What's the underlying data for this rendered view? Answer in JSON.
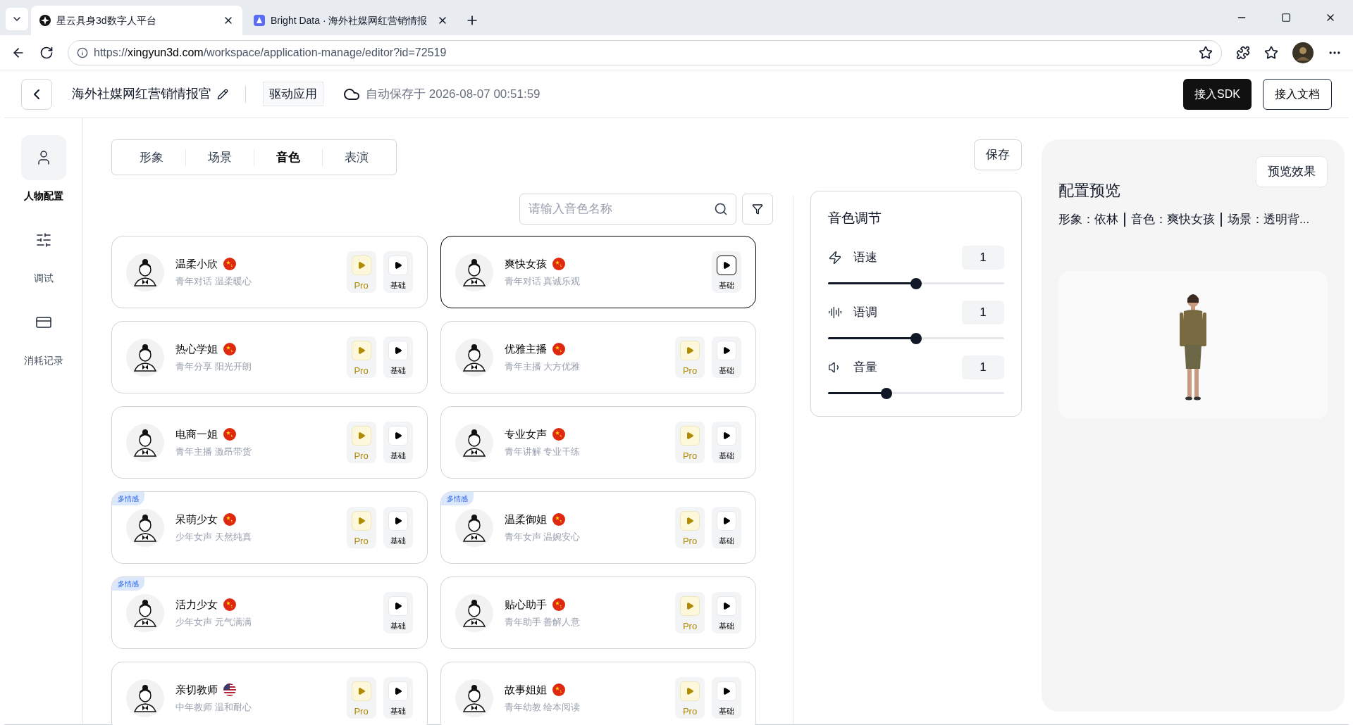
{
  "browser": {
    "tabs": [
      {
        "title": "星云具身3d数字人平台",
        "selected": true,
        "kind": "site"
      },
      {
        "title": "Bright Data · 海外社媒网红营销情报",
        "selected": false,
        "kind": "extension"
      }
    ],
    "address": {
      "scheme": "https://",
      "host": "xingyun3d.com",
      "path": "/workspace/application-manage/editor?id=72519"
    }
  },
  "header": {
    "title": "海外社媒网红营销情报官",
    "tag": "驱动应用",
    "autosave": "自动保存于 2026-08-07 00:51:59",
    "buttons": [
      {
        "label": "接入SDK",
        "kind": "primary"
      },
      {
        "label": "接入文档",
        "kind": "secondary"
      }
    ]
  },
  "sidebar": {
    "items": [
      {
        "label": "人物配置",
        "kind": "person",
        "selected": true
      },
      {
        "label": "调试",
        "kind": "sliders",
        "selected": false
      },
      {
        "label": "消耗记录",
        "kind": "record",
        "selected": false
      }
    ]
  },
  "tabs": [
    {
      "label": "形象",
      "selected": false
    },
    {
      "label": "场景",
      "selected": false
    },
    {
      "label": "音色",
      "selected": true
    },
    {
      "label": "表演",
      "selected": false
    }
  ],
  "search": {
    "placeholder": "请输入音色名称"
  },
  "save": "保存",
  "voices": [
    {
      "name": "温柔小欣",
      "kind": "cn",
      "tags": "青年对话 温柔暖心",
      "pro": true,
      "pro_label": "Pro",
      "basic_label": "基础",
      "selected": false
    },
    {
      "name": "爽快女孩",
      "kind": "cn",
      "tags": "青年对话 真诚乐观",
      "pro": false,
      "basic_label": "基础",
      "selected": true
    },
    {
      "name": "热心学姐",
      "kind": "cn",
      "tags": "青年分享 阳光开朗",
      "pro": true,
      "pro_label": "Pro",
      "basic_label": "基础",
      "selected": false
    },
    {
      "name": "优雅主播",
      "kind": "cn",
      "tags": "青年主播 大方优雅",
      "pro": true,
      "pro_label": "Pro",
      "basic_label": "基础",
      "selected": false
    },
    {
      "name": "电商一姐",
      "kind": "cn",
      "tags": "青年主播 激昂带货",
      "pro": true,
      "pro_label": "Pro",
      "basic_label": "基础",
      "selected": false
    },
    {
      "name": "专业女声",
      "kind": "cn",
      "tags": "青年讲解 专业干练",
      "pro": true,
      "pro_label": "Pro",
      "basic_label": "基础",
      "selected": false
    },
    {
      "name": "呆萌少女",
      "kind": "cn",
      "tags": "少年女声 天然纯真",
      "badge": "多情感",
      "pro": true,
      "pro_label": "Pro",
      "basic_label": "基础",
      "selected": false
    },
    {
      "name": "温柔御姐",
      "kind": "cn",
      "tags": "青年女声 温婉安心",
      "badge": "多情感",
      "pro": true,
      "pro_label": "Pro",
      "basic_label": "基础",
      "selected": false
    },
    {
      "name": "活力少女",
      "kind": "cn",
      "tags": "少年女声 元气满满",
      "badge": "多情感",
      "pro": false,
      "basic_label": "基础",
      "selected": false
    },
    {
      "name": "贴心助手",
      "kind": "cn",
      "tags": "青年助手 善解人意",
      "pro": true,
      "pro_label": "Pro",
      "basic_label": "基础",
      "selected": false
    },
    {
      "name": "亲切教师",
      "kind": "us",
      "tags": "中年教师 温和耐心",
      "pro": true,
      "pro_label": "Pro",
      "basic_label": "基础",
      "selected": false
    },
    {
      "name": "故事姐姐",
      "kind": "cn",
      "tags": "青年幼教 绘本阅读",
      "pro": true,
      "pro_label": "Pro",
      "basic_label": "基础",
      "selected": false
    }
  ],
  "sound": {
    "title": "音色调节",
    "sliders": [
      {
        "kind": "speed",
        "label": "语速",
        "value": "1",
        "level": 0.5
      },
      {
        "kind": "pitch",
        "label": "语调",
        "value": "1",
        "level": 0.5
      },
      {
        "kind": "volume",
        "label": "音量",
        "value": "1",
        "level": 0.33
      }
    ]
  },
  "preview": {
    "button": "预览效果",
    "title": "配置预览",
    "summary": [
      "形象：依林",
      "音色：爽快女孩",
      "场景：透明背..."
    ],
    "figure": {
      "kind": "picture"
    }
  }
}
